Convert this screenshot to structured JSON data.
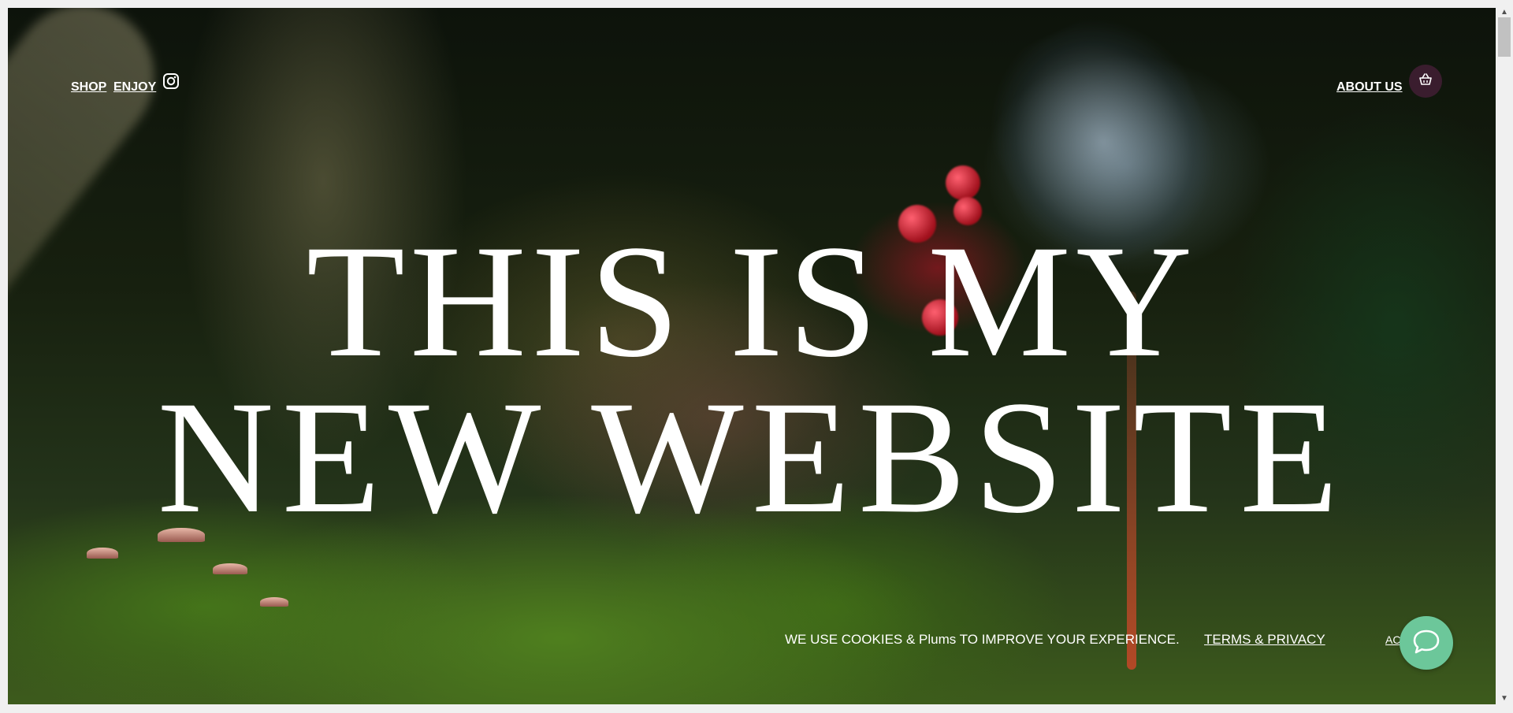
{
  "nav": {
    "shop_label": "SHOP",
    "enjoy_label": "ENJOY",
    "instagram_icon": "instagram-icon",
    "about_label": "ABOUT US",
    "cart_icon": "basket-icon",
    "cart_color": "#3a1d2e"
  },
  "hero": {
    "line1": "THIS IS MY",
    "line2": "NEW WEBSITE"
  },
  "cookie_banner": {
    "text": "WE USE COOKIES & Plums TO IMPROVE YOUR EXPERIENCE.",
    "link_label": "TERMS & PRIVACY",
    "accept_label": "ACCEPT"
  },
  "chat": {
    "icon": "chat-bubble-icon",
    "color": "#6cc79a"
  }
}
